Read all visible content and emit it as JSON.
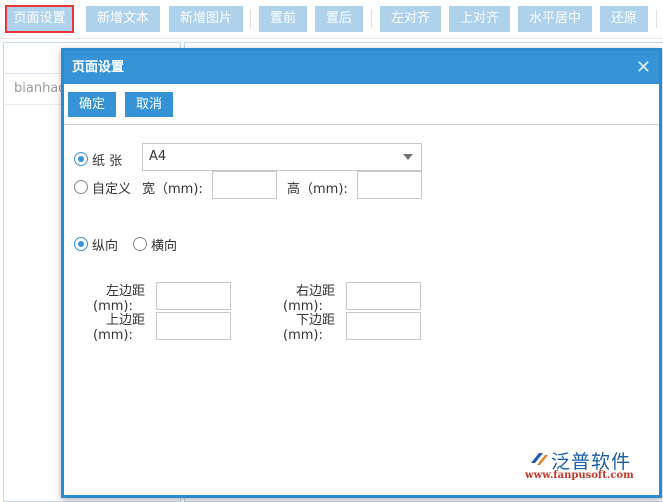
{
  "toolbar": {
    "buttons": [
      {
        "label": "页面设置",
        "active": true
      },
      {
        "label": "新增文本"
      },
      {
        "label": "新增图片"
      },
      {
        "label": "置前"
      },
      {
        "label": "置后"
      },
      {
        "label": "左对齐"
      },
      {
        "label": "上对齐"
      },
      {
        "label": "水平居中"
      },
      {
        "label": "还原"
      }
    ]
  },
  "left_panel": {
    "rows": [
      "bianhao"
    ]
  },
  "dialog": {
    "title": "页面设置",
    "close_icon": "close-icon",
    "buttons": {
      "ok": "确定",
      "cancel": "取消"
    },
    "paper": {
      "label": "纸 张",
      "selected": true,
      "value": "A4"
    },
    "custom": {
      "label": "自定义",
      "selected": false,
      "width_label": "宽（mm):",
      "width_value": "",
      "height_label": "高（mm):",
      "height_value": ""
    },
    "orientation": {
      "portrait": {
        "label": "纵向",
        "selected": true
      },
      "landscape": {
        "label": "横向",
        "selected": false
      }
    },
    "margins": {
      "left": {
        "label": "左边距",
        "unit": "(mm):",
        "value": ""
      },
      "right": {
        "label": "右边距",
        "unit": "(mm):",
        "value": ""
      },
      "top": {
        "label": "上边距",
        "unit": "(mm):",
        "value": ""
      },
      "bottom": {
        "label": "下边距",
        "unit": "(mm):",
        "value": ""
      }
    }
  },
  "watermark": {
    "brand": "泛普软件",
    "url": "www.fanpusoft.com"
  },
  "colors": {
    "accent": "#3593d6",
    "toolbar_button": "#aed2ec",
    "active_outline": "#e8343a"
  }
}
